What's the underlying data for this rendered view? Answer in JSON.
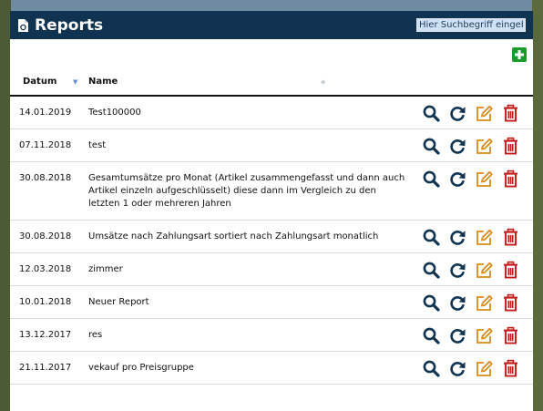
{
  "header": {
    "title": "Reports",
    "search_placeholder": "Hier Suchbegriff eingeben"
  },
  "table": {
    "columns": [
      "Datum",
      "Name"
    ],
    "rows": [
      {
        "date": "14.01.2019",
        "name": "Test100000"
      },
      {
        "date": "07.11.2018",
        "name": "test"
      },
      {
        "date": "30.08.2018",
        "name": "Gesamtumsätze pro Monat (Artikel zusammengefasst und dann auch Artikel einzeln aufgeschlüsselt) diese dann im Vergleich zu den letzten 1 oder mehreren Jahren"
      },
      {
        "date": "30.08.2018",
        "name": "Umsätze nach Zahlungsart sortiert nach Zahlungsart monatlich"
      },
      {
        "date": "12.03.2018",
        "name": "zimmer"
      },
      {
        "date": "10.01.2018",
        "name": "Neuer Report"
      },
      {
        "date": "13.12.2017",
        "name": "res"
      },
      {
        "date": "21.11.2017",
        "name": "vekauf pro Preisgruppe"
      }
    ]
  },
  "icons": {
    "view": "search-icon",
    "refresh": "refresh-icon",
    "edit": "edit-icon",
    "delete": "trash-icon",
    "add": "plus-icon",
    "report": "document-icon"
  },
  "colors": {
    "header_bg": "#0f3350",
    "view": "#0f3350",
    "refresh": "#0f3350",
    "edit": "#d98a1a",
    "delete": "#c41a1a",
    "add": "#1a9a2a"
  }
}
